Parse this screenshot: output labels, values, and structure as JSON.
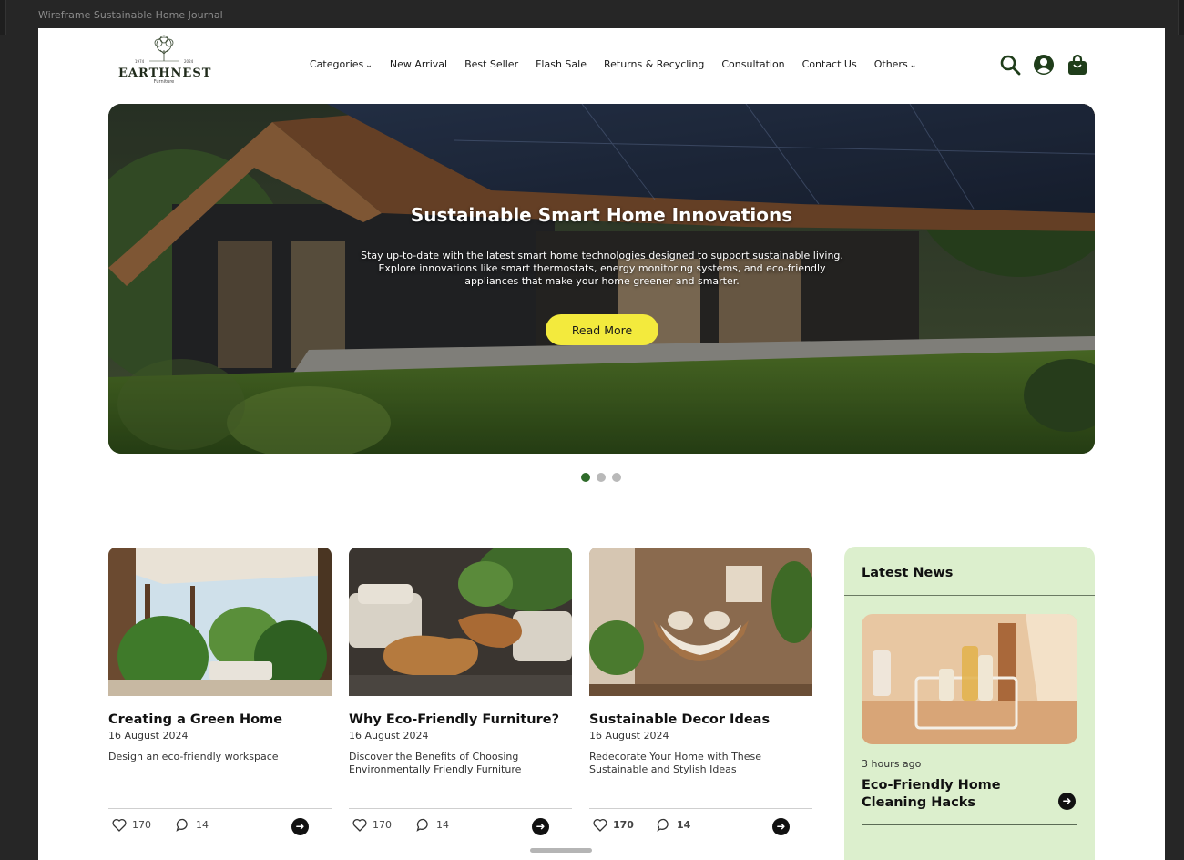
{
  "frame": {
    "title": "Wireframe Sustainable Home Journal"
  },
  "brand": {
    "name": "EARTHNEST",
    "tagline": "Furniture",
    "year_left": "1974",
    "year_right": "2024"
  },
  "nav": [
    {
      "label": "Categories",
      "has_dropdown": true
    },
    {
      "label": "New Arrival",
      "has_dropdown": false
    },
    {
      "label": "Best Seller",
      "has_dropdown": false
    },
    {
      "label": "Flash Sale",
      "has_dropdown": false
    },
    {
      "label": "Returns & Recycling",
      "has_dropdown": false
    },
    {
      "label": "Consultation",
      "has_dropdown": false
    },
    {
      "label": "Contact Us",
      "has_dropdown": false
    },
    {
      "label": "Others",
      "has_dropdown": true
    }
  ],
  "header_icons": [
    "search-icon",
    "user-icon",
    "shopping-bag-icon"
  ],
  "hero": {
    "title": "Sustainable Smart Home Innovations",
    "description": "Stay up-to-date with the latest smart home technologies designed to support sustainable living. Explore innovations like smart thermostats, energy monitoring systems, and eco-friendly appliances that make your home greener and smarter.",
    "button": "Read More",
    "slide_count": 3,
    "active_slide": 1
  },
  "articles": [
    {
      "title": "Creating a Green Home",
      "date": "16 August 2024",
      "description": "Design an eco-friendly workspace",
      "likes": "170",
      "comments": "14"
    },
    {
      "title": "Why Eco-Friendly Furniture?",
      "date": "16 August 2024",
      "description": "Discover the Benefits of Choosing Environmentally Friendly Furniture",
      "likes": "170",
      "comments": "14"
    },
    {
      "title": "Sustainable Decor Ideas",
      "date": "16 August 2024",
      "description": "Redecorate Your Home with These Sustainable and Stylish Ideas",
      "likes": "170",
      "comments": "14"
    }
  ],
  "latest_news": {
    "heading": "Latest News",
    "time": "3 hours ago",
    "headline": "Eco-Friendly Home Cleaning Hacks"
  },
  "colors": {
    "accent_yellow": "#f3ea3d",
    "brand_green": "#1f3d1a",
    "dot_active": "#2f6b2a",
    "news_bg": "#dcefcd"
  }
}
